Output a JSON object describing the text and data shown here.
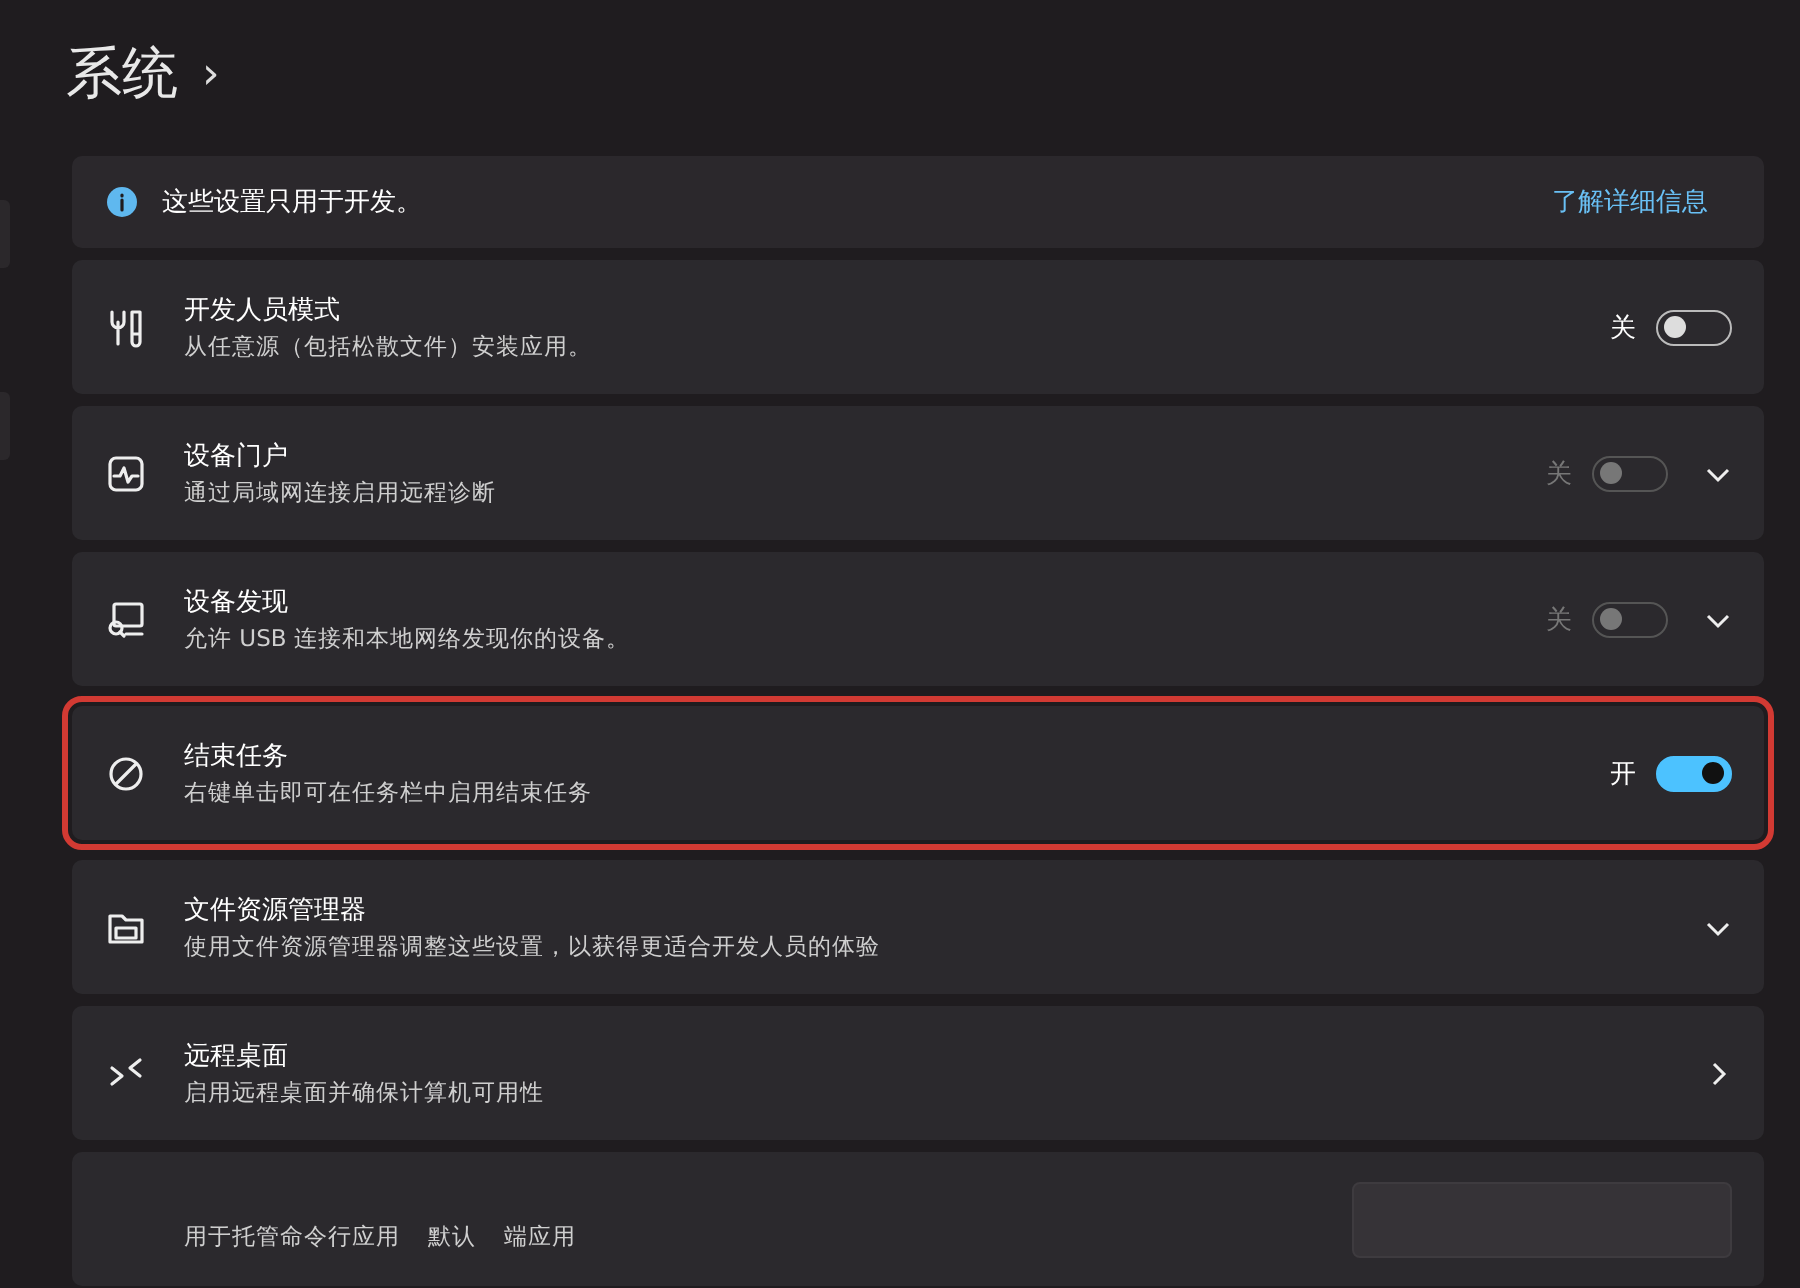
{
  "breadcrumb": {
    "title": "系统",
    "separator": "›"
  },
  "info_bar": {
    "text": "这些设置只用于开发。",
    "link": "了解详细信息"
  },
  "settings": [
    {
      "kind": "toggle",
      "title": "开发人员模式",
      "description": "从任意源（包括松散文件）安装应用。",
      "highlighted": false,
      "toggle": {
        "label": "关",
        "on": false,
        "disabled": false
      }
    },
    {
      "kind": "toggle_expander",
      "title": "设备门户",
      "description": "通过局域网连接启用远程诊断",
      "highlighted": false,
      "toggle": {
        "label": "关",
        "on": false,
        "disabled": true
      }
    },
    {
      "kind": "toggle_expander",
      "title": "设备发现",
      "description": "允许 USB 连接和本地网络发现你的设备。",
      "highlighted": false,
      "toggle": {
        "label": "关",
        "on": false,
        "disabled": true
      }
    },
    {
      "kind": "toggle",
      "title": "结束任务",
      "description": "右键单击即可在任务栏中启用结束任务",
      "highlighted": true,
      "toggle": {
        "label": "开",
        "on": true,
        "disabled": false
      }
    },
    {
      "kind": "expander",
      "title": "文件资源管理器",
      "description": "使用文件资源管理器调整这些设置，以获得更适合开发人员的体验",
      "highlighted": false
    },
    {
      "kind": "link",
      "title": "远程桌面",
      "description": "启用远程桌面并确保计算机可用性",
      "highlighted": false
    },
    {
      "kind": "dropdown",
      "description_parts": [
        "用于托管命令行应用",
        "默认",
        "端应用"
      ],
      "highlighted": false
    }
  ]
}
